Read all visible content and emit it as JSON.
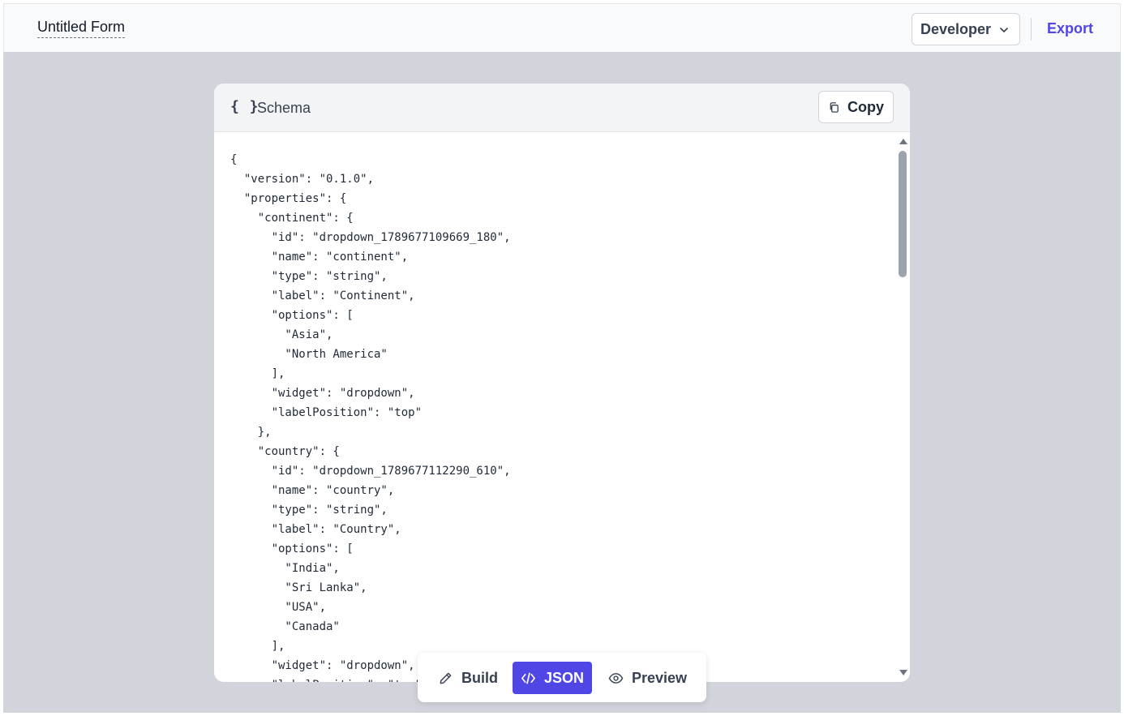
{
  "topbar": {
    "form_title": "Untitled Form",
    "role_selected": "Developer",
    "export_label": "Export"
  },
  "panel": {
    "braces": "{ }",
    "title": "Schema",
    "copy_label": "Copy",
    "code": "{\n  \"version\": \"0.1.0\",\n  \"properties\": {\n    \"continent\": {\n      \"id\": \"dropdown_1789677109669_180\",\n      \"name\": \"continent\",\n      \"type\": \"string\",\n      \"label\": \"Continent\",\n      \"options\": [\n        \"Asia\",\n        \"North America\"\n      ],\n      \"widget\": \"dropdown\",\n      \"labelPosition\": \"top\"\n    },\n    \"country\": {\n      \"id\": \"dropdown_1789677112290_610\",\n      \"name\": \"country\",\n      \"type\": \"string\",\n      \"label\": \"Country\",\n      \"options\": [\n        \"India\",\n        \"Sri Lanka\",\n        \"USA\",\n        \"Canada\"\n      ],\n      \"widget\": \"dropdown\",\n      \"labelPosition\": \"top\""
  },
  "mode_bar": {
    "build_label": "Build",
    "json_label": "JSON",
    "preview_label": "Preview"
  },
  "icons": {
    "chevron": "chevron-down-icon",
    "copy": "copy-icon",
    "build": "pencil-icon",
    "json": "code-icon",
    "preview": "eye-icon"
  },
  "colors": {
    "accent": "#4f46e5",
    "canvas_bg": "#d1d5db"
  }
}
